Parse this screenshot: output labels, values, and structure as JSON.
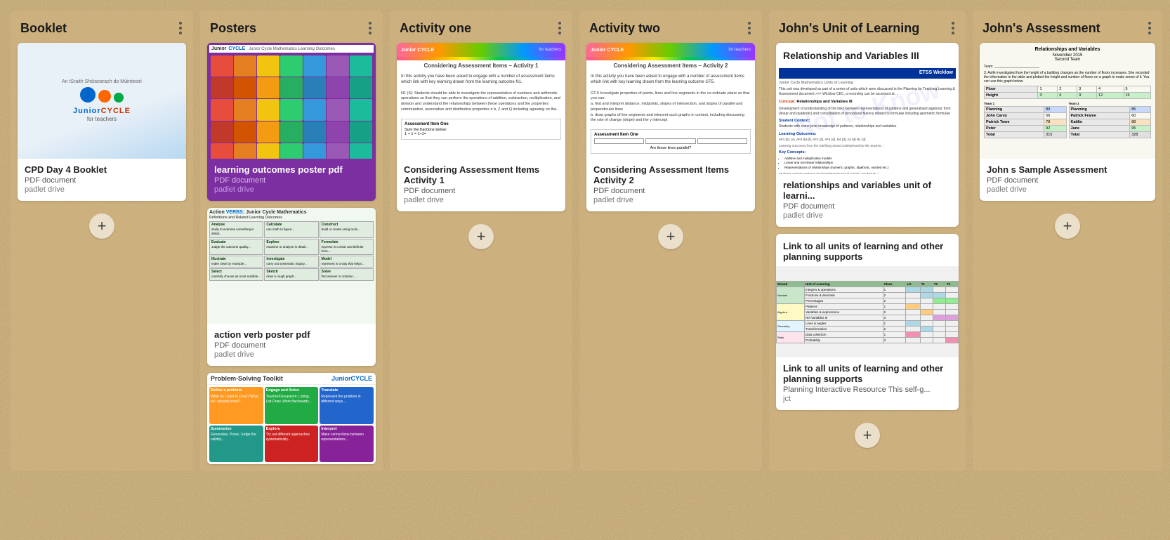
{
  "columns": [
    {
      "id": "booklet",
      "title": "Booklet",
      "cards": [
        {
          "id": "booklet-cpd",
          "title": "CPD Day 4 Booklet",
          "type": "PDF document",
          "source": "padlet drive",
          "thumb_type": "booklet"
        }
      ]
    },
    {
      "id": "posters",
      "title": "Posters",
      "cards": [
        {
          "id": "poster-lo",
          "title": "learning outcomes poster pdf",
          "type": "PDF document",
          "source": "padlet drive",
          "thumb_type": "poster_lo",
          "highlighted": true
        },
        {
          "id": "poster-av",
          "title": "action verb poster pdf",
          "type": "PDF document",
          "source": "padlet drive",
          "thumb_type": "poster_av"
        },
        {
          "id": "poster-ps",
          "title": "Problem-Solving Toolkit",
          "type": "",
          "source": "",
          "thumb_type": "poster_ps"
        }
      ]
    },
    {
      "id": "activity_one",
      "title": "Activity one",
      "cards": [
        {
          "id": "act1-ca",
          "title": "Considering Assessment Items Activity 1",
          "type": "PDF document",
          "source": "padlet drive",
          "thumb_type": "activity1"
        }
      ]
    },
    {
      "id": "activity_two",
      "title": "Activity two",
      "cards": [
        {
          "id": "act2-ca",
          "title": "Considering Assessment Items Activity 2",
          "type": "PDF document",
          "source": "padlet drive",
          "thumb_type": "activity2"
        }
      ]
    },
    {
      "id": "johns_unit",
      "title": "John's Unit of Learning",
      "cards": [
        {
          "id": "unit-rv",
          "title": "relationships and variables unit of learni...",
          "type": "PDF document",
          "source": "padlet drive",
          "thumb_type": "unit_rv"
        },
        {
          "id": "unit-link",
          "title": "Link to all units of learning and other planning supports",
          "type": "Planning Interactive Resource This self-g...",
          "source": "jct",
          "thumb_type": "unit_planning"
        }
      ]
    },
    {
      "id": "johns_assessment",
      "title": "John's Assessment",
      "cards": [
        {
          "id": "assess-sample",
          "title": "John s Sample Assessment",
          "type": "PDF document",
          "source": "padlet drive",
          "thumb_type": "assessment"
        }
      ]
    }
  ],
  "add_button_label": "+",
  "menu_dots": "⋮",
  "colors": {
    "background": "#c8a870",
    "card_bg": "#ffffff",
    "column_bg": "rgba(200,168,100,0.4)"
  },
  "booklet_logo": "Junior CYCLE",
  "booklet_subtitle": "for teachers",
  "booklet_card_title_line1": "An tSraith Shóisearach do Múinteoirí"
}
